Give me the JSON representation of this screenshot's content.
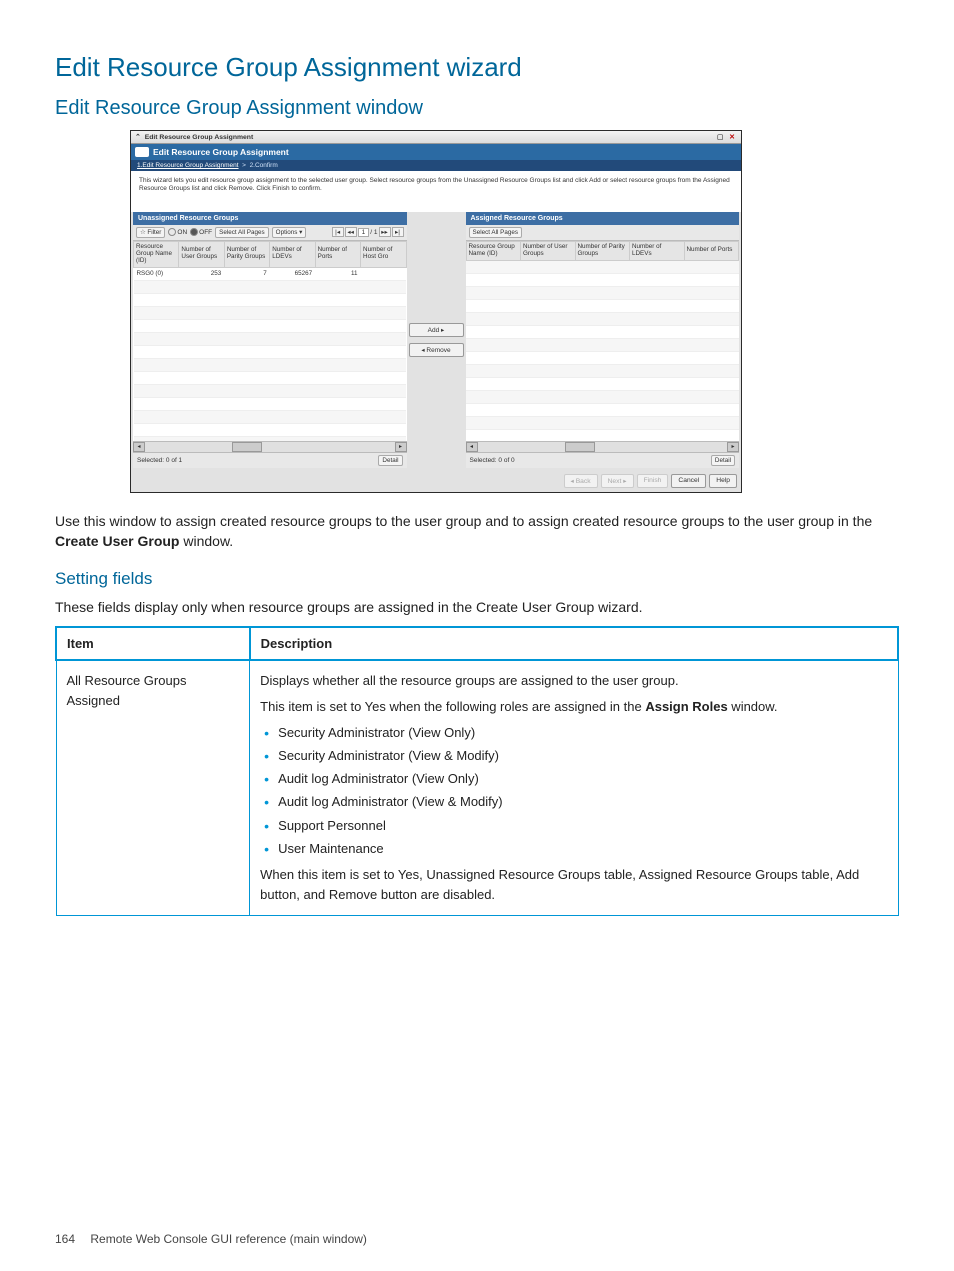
{
  "heading": "Edit Resource Group Assignment wizard",
  "subheading": "Edit Resource Group Assignment window",
  "screenshot": {
    "window_title": "Edit Resource Group Assignment",
    "header_title": "Edit Resource Group Assignment",
    "breadcrumb_step1": "1.Edit Resource Group Assignment",
    "breadcrumb_step2": "2.Confirm",
    "instructions": "This wizard lets you edit resource group assignment to the selected user group. Select resource groups from the Unassigned Resource Groups list and click Add or select resource groups from the Assigned Resource Groups list and click Remove. Click Finish to confirm.",
    "unassigned": {
      "title": "Unassigned Resource Groups",
      "filter_label": "Filter",
      "on_label": "ON",
      "off_label": "OFF",
      "select_all": "Select All Pages",
      "options": "Options ▾",
      "page_cur": "1",
      "page_total": "/ 1",
      "cols": {
        "c1": "Resource Group Name (ID)",
        "c2": "Number of User Groups",
        "c3": "Number of Parity Groups",
        "c4": "Number of LDEVs",
        "c5": "Number of Ports",
        "c6": "Number of Host Gro"
      },
      "row1": {
        "name": "RSG0 (0)",
        "ug": "253",
        "pg": "7",
        "ldev": "65267",
        "ports": "11",
        "hg": ""
      },
      "selected": "Selected: 0  of 1",
      "detail": "Detail"
    },
    "assigned": {
      "title": "Assigned Resource Groups",
      "select_all": "Select All Pages",
      "cols": {
        "c1": "Resource Group Name (ID)",
        "c2": "Number of User Groups",
        "c3": "Number of Parity Groups",
        "c4": "Number of LDEVs",
        "c5": "Number of Ports"
      },
      "selected": "Selected: 0  of 0",
      "detail": "Detail"
    },
    "buttons": {
      "add": "Add ▸",
      "remove": "◂ Remove",
      "back": "◂ Back",
      "next": "Next ▸",
      "finish": "Finish",
      "cancel": "Cancel",
      "help": "Help"
    }
  },
  "body1_pre": "Use this window to assign created resource groups to the user group and to assign created resource groups to the user group in the ",
  "body1_bold": "Create User Group",
  "body1_post": " window.",
  "setting_heading": "Setting fields",
  "setting_intro": "These fields display only when resource groups are assigned in the Create User Group wizard.",
  "table": {
    "h1": "Item",
    "h2": "Description",
    "item": "All Resource Groups Assigned",
    "d1": "Displays whether all the resource groups are assigned to the user group.",
    "d2_pre": "This item is set to Yes when the following roles are assigned in the ",
    "d2_bold": "Assign Roles",
    "d2_post": " window.",
    "bullets": [
      "Security Administrator (View Only)",
      "Security Administrator (View & Modify)",
      "Audit log Administrator (View Only)",
      "Audit log Administrator (View & Modify)",
      "Support Personnel",
      "User Maintenance"
    ],
    "d3": "When this item is set to Yes, Unassigned Resource Groups table, Assigned Resource Groups table, Add button, and Remove button are disabled."
  },
  "footer": {
    "page": "164",
    "ref": "Remote Web Console GUI reference (main window)"
  }
}
